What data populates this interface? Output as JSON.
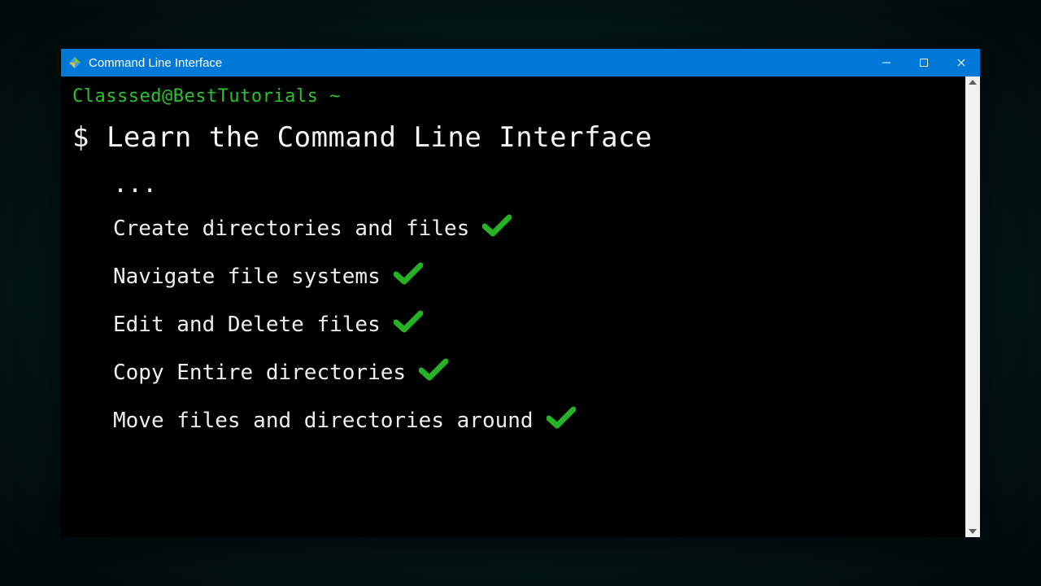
{
  "window": {
    "title": "Command Line Interface"
  },
  "terminal": {
    "prompt": "Classsed@BestTutorials ~",
    "headline_prefix": "$ ",
    "headline": "Learn the Command Line Interface",
    "dots": "...",
    "items": [
      "Create directories and files",
      "Navigate file systems",
      "Edit and Delete files",
      "Copy Entire directories",
      "Move files and directories around"
    ]
  },
  "colors": {
    "titlebar": "#0078d7",
    "prompt_green": "#2bc22b",
    "check_green": "#26b126"
  }
}
